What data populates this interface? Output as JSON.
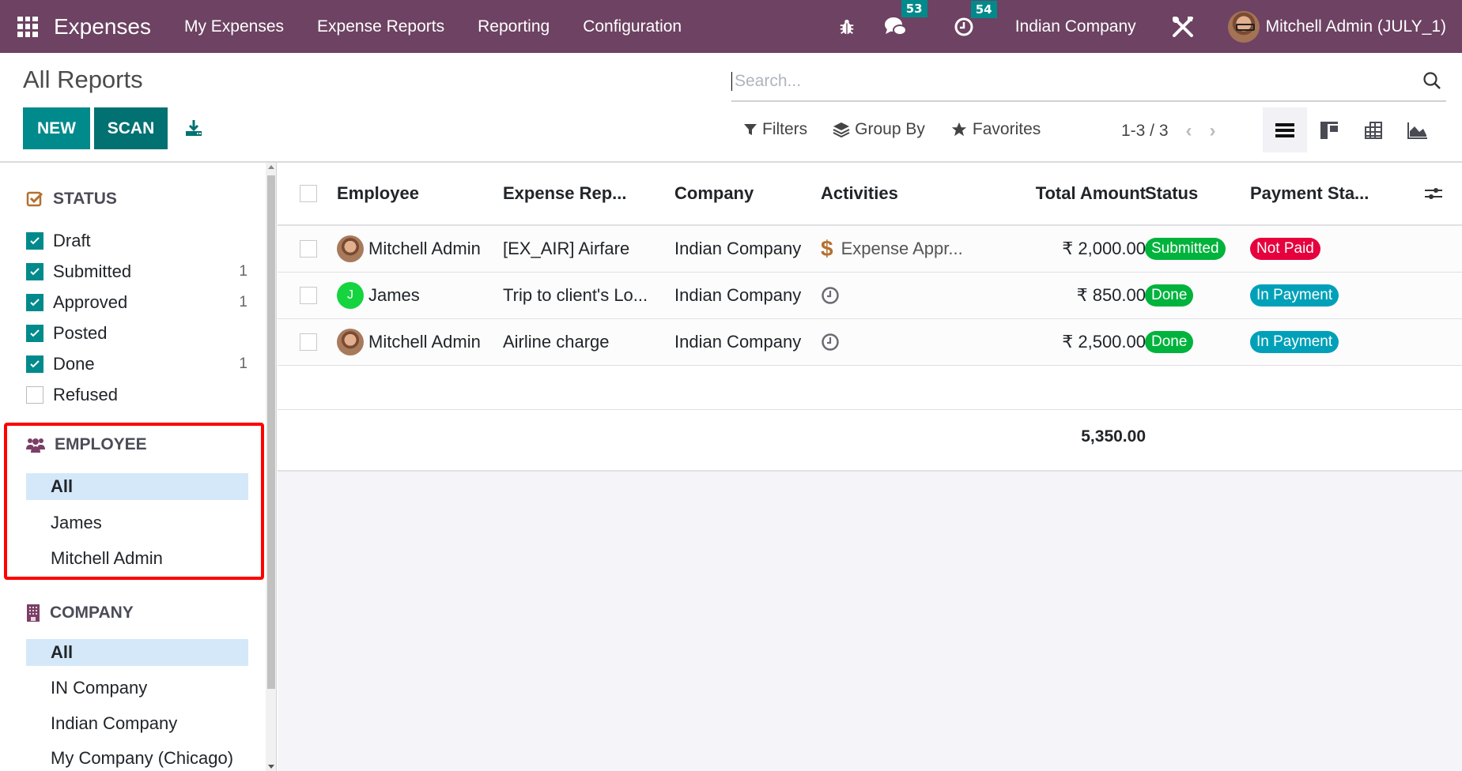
{
  "navbar": {
    "app_name": "Expenses",
    "menu": [
      "My Expenses",
      "Expense Reports",
      "Reporting",
      "Configuration"
    ],
    "messages_count": "53",
    "activities_count": "54",
    "company": "Indian Company",
    "user": "Mitchell Admin (JULY_1)"
  },
  "control_panel": {
    "title": "All Reports",
    "new_label": "NEW",
    "scan_label": "SCAN",
    "search_placeholder": "Search...",
    "filters_label": "Filters",
    "groupby_label": "Group By",
    "favorites_label": "Favorites",
    "pager": "1-3 / 3",
    "views": [
      "list",
      "kanban",
      "pivot",
      "graph"
    ],
    "active_view": "list"
  },
  "sidebar": {
    "status": {
      "title": "STATUS",
      "items": [
        {
          "label": "Draft",
          "checked": true,
          "count": ""
        },
        {
          "label": "Submitted",
          "checked": true,
          "count": "1"
        },
        {
          "label": "Approved",
          "checked": true,
          "count": "1"
        },
        {
          "label": "Posted",
          "checked": true,
          "count": ""
        },
        {
          "label": "Done",
          "checked": true,
          "count": "1"
        },
        {
          "label": "Refused",
          "checked": false,
          "count": ""
        }
      ]
    },
    "employee": {
      "title": "EMPLOYEE",
      "items": [
        "All",
        "James",
        "Mitchell Admin"
      ],
      "active": "All"
    },
    "company": {
      "title": "COMPANY",
      "items": [
        "All",
        "IN Company",
        "Indian Company",
        "My Company (Chicago)"
      ],
      "active": "All"
    }
  },
  "table": {
    "headers": [
      "Employee",
      "Expense Rep...",
      "Company",
      "Activities",
      "Total Amount",
      "Status",
      "Payment Sta..."
    ],
    "rows": [
      {
        "employee": "Mitchell Admin",
        "avatar": "photo",
        "report": "[EX_AIR] Airfare",
        "company": "Indian Company",
        "activity_icon": "dollar-icon",
        "activity": "Expense Appr...",
        "amount": "₹ 2,000.00",
        "status": "Submitted",
        "payment": "Not Paid"
      },
      {
        "employee": "James",
        "avatar": "J",
        "report": "Trip to client's Lo...",
        "company": "Indian Company",
        "activity_icon": "clock-icon",
        "activity": "",
        "amount": "₹ 850.00",
        "status": "Done",
        "payment": "In Payment"
      },
      {
        "employee": "Mitchell Admin",
        "avatar": "photo",
        "report": "Airline charge",
        "company": "Indian Company",
        "activity_icon": "clock-icon",
        "activity": "",
        "amount": "₹ 2,500.00",
        "status": "Done",
        "payment": "In Payment"
      }
    ],
    "total": "5,350.00"
  },
  "colors": {
    "navbar": "#6d4262",
    "primary": "#018a8b",
    "status_green": "#00b33c",
    "not_paid_red": "#e6003d",
    "in_payment_teal": "#00a1b8",
    "highlight": "#ff0000"
  }
}
